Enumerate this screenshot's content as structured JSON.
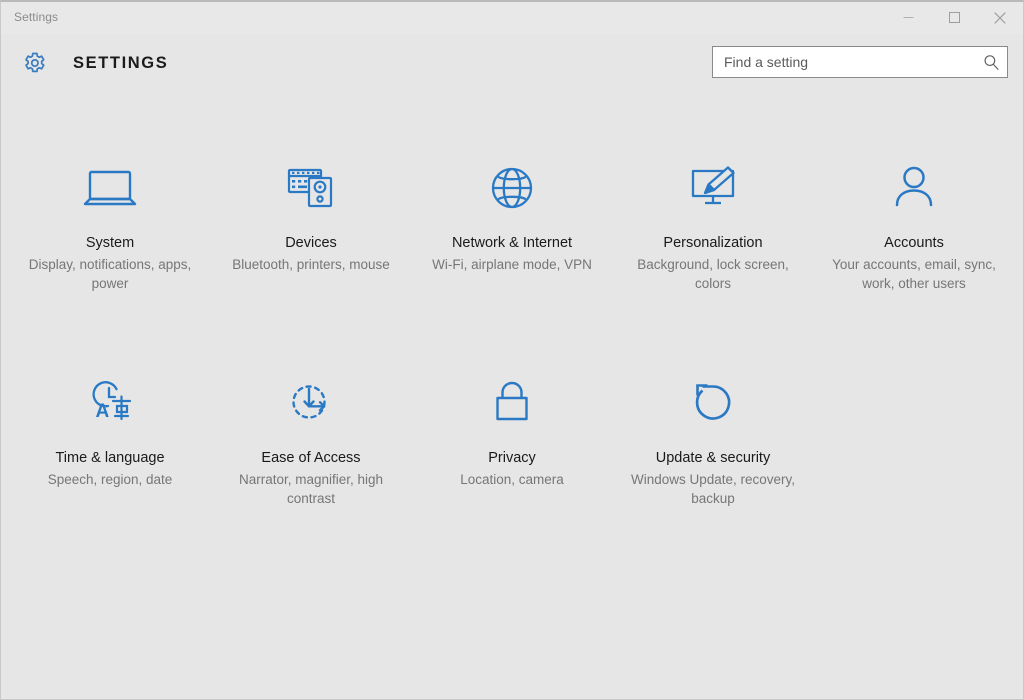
{
  "window": {
    "titlebar_caption": "Settings",
    "controls": [
      {
        "name": "minimize",
        "glyph": "minimize-icon",
        "label": "Minimize"
      },
      {
        "name": "maximize",
        "glyph": "maximize-icon",
        "label": "Maximize"
      },
      {
        "name": "close",
        "glyph": "close-icon",
        "label": "Close"
      }
    ]
  },
  "header": {
    "gear_icon": "gear-icon",
    "title": "SETTINGS"
  },
  "search": {
    "placeholder": "Find a setting",
    "value": "",
    "icon": "search-icon"
  },
  "colors": {
    "accent": "#2a79c4",
    "window_bg": "#e6e6e6",
    "title_text": "#1a1a1a",
    "desc_text": "#767676",
    "caption_text": "#8b8b8b"
  },
  "tiles": [
    {
      "id": "system",
      "icon": "laptop-icon",
      "title": "System",
      "desc": "Display, notifications, apps, power"
    },
    {
      "id": "devices",
      "icon": "keyboard-speaker-icon",
      "title": "Devices",
      "desc": "Bluetooth, printers, mouse"
    },
    {
      "id": "network-internet",
      "icon": "globe-icon",
      "title": "Network & Internet",
      "desc": "Wi-Fi, airplane mode, VPN"
    },
    {
      "id": "personalization",
      "icon": "monitor-paintbrush-icon",
      "title": "Personalization",
      "desc": "Background, lock screen, colors"
    },
    {
      "id": "accounts",
      "icon": "person-icon",
      "title": "Accounts",
      "desc": "Your accounts, email, sync, work, other users"
    },
    {
      "id": "time-language",
      "icon": "clock-language-icon",
      "title": "Time & language",
      "desc": "Speech, region, date"
    },
    {
      "id": "ease-of-access",
      "icon": "ease-of-access-icon",
      "title": "Ease of Access",
      "desc": "Narrator, magnifier, high contrast"
    },
    {
      "id": "privacy",
      "icon": "lock-icon",
      "title": "Privacy",
      "desc": "Location, camera"
    },
    {
      "id": "update-security",
      "icon": "refresh-icon",
      "title": "Update & security",
      "desc": "Windows Update, recovery, backup"
    }
  ]
}
